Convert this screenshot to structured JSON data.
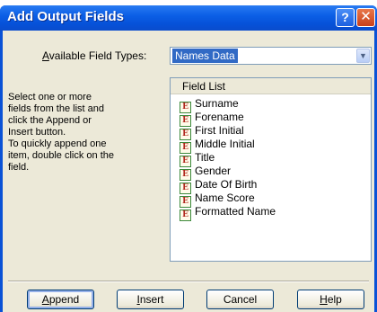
{
  "window": {
    "title": "Add Output Fields",
    "help_glyph": "?",
    "close_glyph": "✕"
  },
  "field_types": {
    "label_underlined": "A",
    "label_rest": "vailable Field Types:",
    "selected": "Names Data",
    "arrow": "▼"
  },
  "instructions": {
    "para1": "Select one or more fields from the list and click the Append or Insert button.",
    "para2": "To quickly append one item, double click on the field."
  },
  "field_list": {
    "header": "Field List",
    "icon_glyph": "E",
    "items": [
      "Surname",
      "Forename",
      "First Initial",
      "Middle Initial",
      "Title",
      "Gender",
      "Date Of Birth",
      "Name Score",
      "Formatted Name"
    ]
  },
  "buttons": {
    "append": {
      "u": "A",
      "rest": "ppend"
    },
    "insert": {
      "u": "I",
      "rest": "nsert"
    },
    "cancel": {
      "label": "Cancel"
    },
    "help": {
      "u": "H",
      "rest": "elp"
    }
  },
  "colors": {
    "title_blue": "#0a52d6",
    "dialog_face": "#ece9d8",
    "selection": "#316ac5"
  }
}
